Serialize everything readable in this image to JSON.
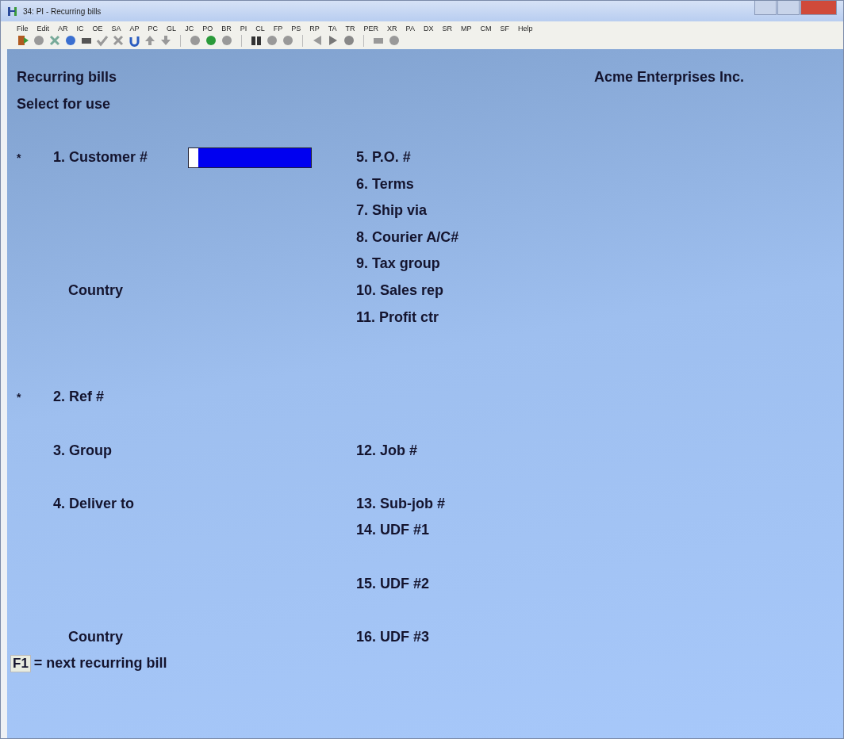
{
  "window": {
    "title": "34: PI - Recurring bills"
  },
  "menu": [
    "File",
    "Edit",
    "AR",
    "IC",
    "OE",
    "SA",
    "AP",
    "PC",
    "GL",
    "JC",
    "PO",
    "BR",
    "PI",
    "CL",
    "FP",
    "PS",
    "RP",
    "TA",
    "TR",
    "PER",
    "XR",
    "PA",
    "DX",
    "SR",
    "MP",
    "CM",
    "SF",
    "Help"
  ],
  "screen": {
    "title": "Recurring bills",
    "company": "Acme Enterprises Inc.",
    "mode": "Select for use"
  },
  "left_fields": [
    {
      "mark": "*",
      "label": "1. Customer #",
      "kind": "field"
    },
    {
      "label": "Country",
      "kind": "sub"
    },
    {
      "mark": "*",
      "label": "2. Ref #",
      "kind": "label"
    },
    {
      "label": "3. Group",
      "kind": "label"
    },
    {
      "label": "4. Deliver to",
      "kind": "label"
    },
    {
      "label": "Country",
      "kind": "sub"
    }
  ],
  "right_fields": [
    "5. P.O. #",
    "6. Terms",
    "7. Ship via",
    "8. Courier A/C#",
    "9. Tax group",
    "10. Sales rep",
    "11. Profit ctr",
    "12. Job #",
    "13. Sub-job #",
    "14. UDF #1",
    "15. UDF #2",
    "16. UDF #3"
  ],
  "hint": {
    "key": "F1",
    "text": "= next recurring bill"
  }
}
